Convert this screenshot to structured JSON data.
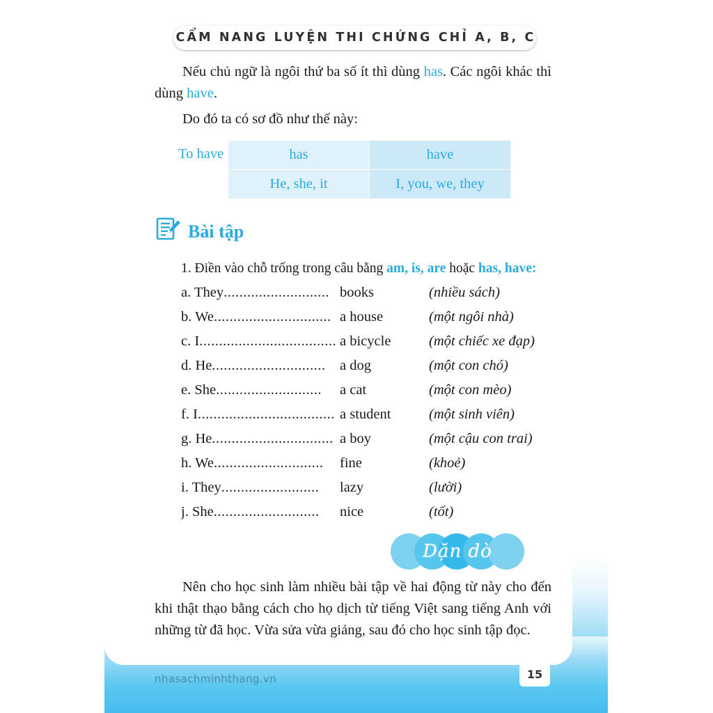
{
  "header": {
    "title": "CẨM NANG LUYỆN THI CHỨNG CHỈ A, B, C"
  },
  "intro": {
    "paragraph1_part1": "Nếu chủ ngữ là ngôi thứ ba số ít thì dùng ",
    "paragraph1_hl1": "has",
    "paragraph1_part2": ". Các ngôi khác thì dùng ",
    "paragraph1_hl2": "have",
    "paragraph1_part3": ".",
    "paragraph2": "Do đó ta có sơ đồ như thế này:"
  },
  "table": {
    "label": "To have",
    "rows": [
      {
        "col_a": "has",
        "col_b": "have"
      },
      {
        "col_a": "He, she, it",
        "col_b": "I, you, we, they"
      }
    ]
  },
  "exercises": {
    "section_title": "Bài tập",
    "section_icon": "document-pencil-icon",
    "question_prefix": "1. Điền vào chỗ trống trong câu bằng ",
    "question_hl1": "am, is, are",
    "question_mid": " hoặc ",
    "question_hl2": "has, have:",
    "items": [
      {
        "label": "a. They",
        "dots": "...........................",
        "answer": "books",
        "vi": "(nhiều sách)"
      },
      {
        "label": "b. We",
        "dots": "..............................",
        "answer": "a house",
        "vi": "(một ngôi nhà)"
      },
      {
        "label": "c. I",
        "dots": "...................................",
        "answer": "a bicycle",
        "vi": "(một chiếc xe đạp)"
      },
      {
        "label": "d. He",
        "dots": ".............................",
        "answer": "a dog",
        "vi": "(một con chó)"
      },
      {
        "label": "e. She",
        "dots": "...........................",
        "answer": "a cat",
        "vi": "(một con mèo)"
      },
      {
        "label": "f. I",
        "dots": "...................................",
        "answer": "a student",
        "vi": "(một sinh viên)"
      },
      {
        "label": "g. He",
        "dots": "...............................",
        "answer": "a boy",
        "vi": "(một cậu con trai)"
      },
      {
        "label": "h. We",
        "dots": "............................",
        "answer": "fine",
        "vi": "(khoẻ)"
      },
      {
        "label": "i. They",
        "dots": ".........................",
        "answer": "lazy",
        "vi": "(lười)"
      },
      {
        "label": "j. She",
        "dots": "...........................",
        "answer": "nice",
        "vi": "(tốt)"
      }
    ]
  },
  "badge": {
    "label": "Dặn dò"
  },
  "closing": {
    "paragraph": "Nên cho học sinh làm nhiều bài tập về hai động từ này cho đến khi thật thạo bằng cách cho họ dịch từ tiếng Việt sang tiếng Anh với những từ đã học. Vừa sửa vừa giảng, sau đó cho học sinh tập đọc."
  },
  "footer": {
    "url": "nhasachminhthang.vn",
    "page_number": "15"
  },
  "colors": {
    "accent_blue": "#29ABE2",
    "table_col_a": "#dff1fb",
    "table_col_b": "#cbe9f9",
    "band_blue": "#46beee",
    "title_gray": "#2f3133"
  }
}
